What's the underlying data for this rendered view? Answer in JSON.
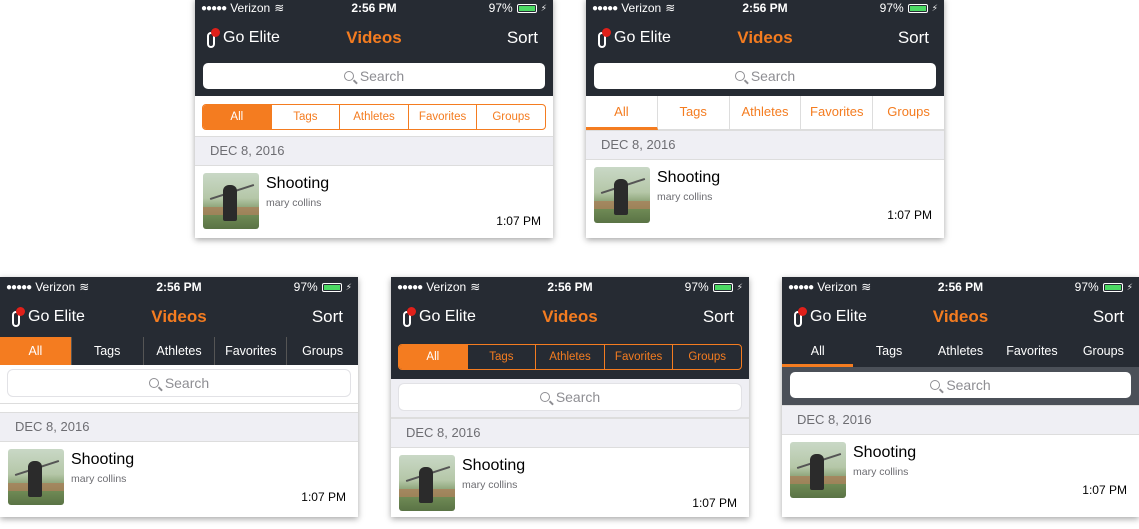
{
  "status": {
    "carrier": "Verizon",
    "time": "2:56 PM",
    "battery": "97%"
  },
  "nav": {
    "brand": "Go Elite",
    "title": "Videos",
    "sort": "Sort"
  },
  "search_placeholder": "Search",
  "tabs": [
    "All",
    "Tags",
    "Athletes",
    "Favorites",
    "Groups"
  ],
  "section_date": "DEC 8, 2016",
  "video": {
    "title": "Shooting",
    "author": "mary collins",
    "time": "1:07 PM"
  },
  "colors": {
    "accent": "#f47c20",
    "dark": "#262b33"
  }
}
